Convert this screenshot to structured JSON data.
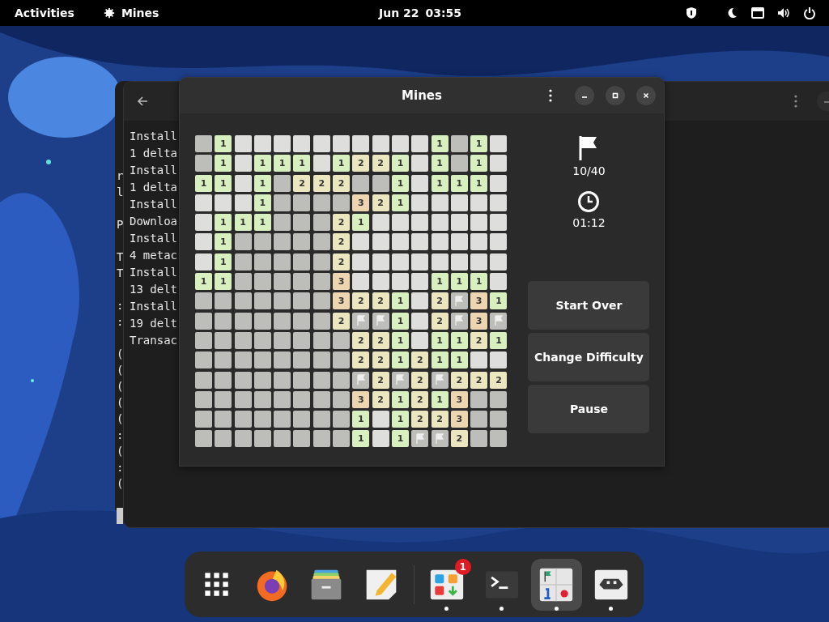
{
  "top_bar": {
    "activities": "Activities",
    "app_name": "Mines",
    "date": "Jun 22",
    "time": "03:55"
  },
  "background_terminal": {
    "line_groups": [
      [
        "r",
        "l"
      ],
      [
        "P"
      ],
      [
        "T",
        "T"
      ],
      [
        ":",
        ":"
      ],
      [
        "(",
        "(",
        "(",
        "(",
        "(",
        ":",
        "(",
        ":",
        "("
      ]
    ]
  },
  "terminal": {
    "lines": [
      "Install",
      "1 delta",
      "Install",
      "1 delta",
      "Install",
      "Downloa",
      "Install",
      "4 metac",
      "Install",
      "13 delt",
      "Install",
      "19 delt",
      "Transac"
    ]
  },
  "mines_window": {
    "title": "Mines",
    "field": {
      "rows": [
        [
          {
            "kind": "hidden"
          },
          {
            "kind": "number",
            "text": "1"
          },
          {
            "kind": "open"
          },
          {
            "kind": "open"
          },
          {
            "kind": "open"
          },
          {
            "kind": "open"
          },
          {
            "kind": "open"
          },
          {
            "kind": "open"
          },
          {
            "kind": "open"
          },
          {
            "kind": "open"
          },
          {
            "kind": "open"
          },
          {
            "kind": "open"
          },
          {
            "kind": "number",
            "text": "1"
          },
          {
            "kind": "hidden"
          },
          {
            "kind": "number",
            "text": "1"
          },
          {
            "kind": "open"
          }
        ],
        [
          {
            "kind": "hidden"
          },
          {
            "kind": "number",
            "text": "1"
          },
          {
            "kind": "open"
          },
          {
            "kind": "number",
            "text": "1"
          },
          {
            "kind": "number",
            "text": "1"
          },
          {
            "kind": "number",
            "text": "1"
          },
          {
            "kind": "open"
          },
          {
            "kind": "number",
            "text": "1"
          },
          {
            "kind": "number",
            "text": "2"
          },
          {
            "kind": "number",
            "text": "2"
          },
          {
            "kind": "number",
            "text": "1"
          },
          {
            "kind": "open"
          },
          {
            "kind": "number",
            "text": "1"
          },
          {
            "kind": "hidden"
          },
          {
            "kind": "number",
            "text": "1"
          },
          {
            "kind": "open"
          }
        ],
        [
          {
            "kind": "number",
            "text": "1"
          },
          {
            "kind": "number",
            "text": "1"
          },
          {
            "kind": "open"
          },
          {
            "kind": "number",
            "text": "1"
          },
          {
            "kind": "hidden"
          },
          {
            "kind": "number",
            "text": "2"
          },
          {
            "kind": "number",
            "text": "2"
          },
          {
            "kind": "number",
            "text": "2"
          },
          {
            "kind": "hidden"
          },
          {
            "kind": "hidden"
          },
          {
            "kind": "number",
            "text": "1"
          },
          {
            "kind": "open"
          },
          {
            "kind": "number",
            "text": "1"
          },
          {
            "kind": "number",
            "text": "1"
          },
          {
            "kind": "number",
            "text": "1"
          },
          {
            "kind": "open"
          }
        ],
        [
          {
            "kind": "open"
          },
          {
            "kind": "open"
          },
          {
            "kind": "open"
          },
          {
            "kind": "number",
            "text": "1"
          },
          {
            "kind": "hidden"
          },
          {
            "kind": "hidden"
          },
          {
            "kind": "hidden"
          },
          {
            "kind": "hidden"
          },
          {
            "kind": "number",
            "text": "3"
          },
          {
            "kind": "number",
            "text": "2"
          },
          {
            "kind": "number",
            "text": "1"
          },
          {
            "kind": "open"
          },
          {
            "kind": "open"
          },
          {
            "kind": "open"
          },
          {
            "kind": "open"
          },
          {
            "kind": "open"
          }
        ],
        [
          {
            "kind": "open"
          },
          {
            "kind": "number",
            "text": "1"
          },
          {
            "kind": "number",
            "text": "1"
          },
          {
            "kind": "number",
            "text": "1"
          },
          {
            "kind": "hidden"
          },
          {
            "kind": "hidden"
          },
          {
            "kind": "hidden"
          },
          {
            "kind": "number",
            "text": "2"
          },
          {
            "kind": "number",
            "text": "1"
          },
          {
            "kind": "open"
          },
          {
            "kind": "open"
          },
          {
            "kind": "open"
          },
          {
            "kind": "open"
          },
          {
            "kind": "open"
          },
          {
            "kind": "open"
          },
          {
            "kind": "open"
          }
        ],
        [
          {
            "kind": "open"
          },
          {
            "kind": "number",
            "text": "1"
          },
          {
            "kind": "hidden"
          },
          {
            "kind": "hidden"
          },
          {
            "kind": "hidden"
          },
          {
            "kind": "hidden"
          },
          {
            "kind": "hidden"
          },
          {
            "kind": "number",
            "text": "2"
          },
          {
            "kind": "open"
          },
          {
            "kind": "open"
          },
          {
            "kind": "open"
          },
          {
            "kind": "open"
          },
          {
            "kind": "open"
          },
          {
            "kind": "open"
          },
          {
            "kind": "open"
          },
          {
            "kind": "open"
          }
        ],
        [
          {
            "kind": "open"
          },
          {
            "kind": "number",
            "text": "1"
          },
          {
            "kind": "hidden"
          },
          {
            "kind": "hidden"
          },
          {
            "kind": "hidden"
          },
          {
            "kind": "hidden"
          },
          {
            "kind": "hidden"
          },
          {
            "kind": "number",
            "text": "2"
          },
          {
            "kind": "open"
          },
          {
            "kind": "open"
          },
          {
            "kind": "open"
          },
          {
            "kind": "open"
          },
          {
            "kind": "open"
          },
          {
            "kind": "open"
          },
          {
            "kind": "open"
          },
          {
            "kind": "open"
          }
        ],
        [
          {
            "kind": "number",
            "text": "1"
          },
          {
            "kind": "number",
            "text": "1"
          },
          {
            "kind": "hidden"
          },
          {
            "kind": "hidden"
          },
          {
            "kind": "hidden"
          },
          {
            "kind": "hidden"
          },
          {
            "kind": "hidden"
          },
          {
            "kind": "number",
            "text": "3"
          },
          {
            "kind": "open"
          },
          {
            "kind": "open"
          },
          {
            "kind": "open"
          },
          {
            "kind": "open"
          },
          {
            "kind": "number",
            "text": "1"
          },
          {
            "kind": "number",
            "text": "1"
          },
          {
            "kind": "number",
            "text": "1"
          },
          {
            "kind": "open"
          }
        ],
        [
          {
            "kind": "hidden"
          },
          {
            "kind": "hidden"
          },
          {
            "kind": "hidden"
          },
          {
            "kind": "hidden"
          },
          {
            "kind": "hidden"
          },
          {
            "kind": "hidden"
          },
          {
            "kind": "hidden"
          },
          {
            "kind": "number",
            "text": "3"
          },
          {
            "kind": "number",
            "text": "2"
          },
          {
            "kind": "number",
            "text": "2"
          },
          {
            "kind": "number",
            "text": "1"
          },
          {
            "kind": "open"
          },
          {
            "kind": "number",
            "text": "2"
          },
          {
            "kind": "flag"
          },
          {
            "kind": "number",
            "text": "3"
          },
          {
            "kind": "number",
            "text": "1"
          }
        ],
        [
          {
            "kind": "hidden"
          },
          {
            "kind": "hidden"
          },
          {
            "kind": "hidden"
          },
          {
            "kind": "hidden"
          },
          {
            "kind": "hidden"
          },
          {
            "kind": "hidden"
          },
          {
            "kind": "hidden"
          },
          {
            "kind": "number",
            "text": "2"
          },
          {
            "kind": "flag"
          },
          {
            "kind": "flag"
          },
          {
            "kind": "number",
            "text": "1"
          },
          {
            "kind": "open"
          },
          {
            "kind": "number",
            "text": "2"
          },
          {
            "kind": "flag"
          },
          {
            "kind": "number",
            "text": "3"
          },
          {
            "kind": "flag"
          }
        ],
        [
          {
            "kind": "hidden"
          },
          {
            "kind": "hidden"
          },
          {
            "kind": "hidden"
          },
          {
            "kind": "hidden"
          },
          {
            "kind": "hidden"
          },
          {
            "kind": "hidden"
          },
          {
            "kind": "hidden"
          },
          {
            "kind": "hidden"
          },
          {
            "kind": "number",
            "text": "2"
          },
          {
            "kind": "number",
            "text": "2"
          },
          {
            "kind": "number",
            "text": "1"
          },
          {
            "kind": "open"
          },
          {
            "kind": "number",
            "text": "1"
          },
          {
            "kind": "number",
            "text": "1"
          },
          {
            "kind": "number",
            "text": "2"
          },
          {
            "kind": "number",
            "text": "1"
          }
        ],
        [
          {
            "kind": "hidden"
          },
          {
            "kind": "hidden"
          },
          {
            "kind": "hidden"
          },
          {
            "kind": "hidden"
          },
          {
            "kind": "hidden"
          },
          {
            "kind": "hidden"
          },
          {
            "kind": "hidden"
          },
          {
            "kind": "hidden"
          },
          {
            "kind": "number",
            "text": "2"
          },
          {
            "kind": "number",
            "text": "2"
          },
          {
            "kind": "number",
            "text": "1"
          },
          {
            "kind": "number",
            "text": "2"
          },
          {
            "kind": "number",
            "text": "1"
          },
          {
            "kind": "number",
            "text": "1"
          },
          {
            "kind": "open"
          },
          {
            "kind": "open"
          }
        ],
        [
          {
            "kind": "hidden"
          },
          {
            "kind": "hidden"
          },
          {
            "kind": "hidden"
          },
          {
            "kind": "hidden"
          },
          {
            "kind": "hidden"
          },
          {
            "kind": "hidden"
          },
          {
            "kind": "hidden"
          },
          {
            "kind": "hidden"
          },
          {
            "kind": "flag"
          },
          {
            "kind": "number",
            "text": "2"
          },
          {
            "kind": "flag"
          },
          {
            "kind": "number",
            "text": "2"
          },
          {
            "kind": "flag"
          },
          {
            "kind": "number",
            "text": "2"
          },
          {
            "kind": "number",
            "text": "2"
          },
          {
            "kind": "number",
            "text": "2"
          }
        ],
        [
          {
            "kind": "hidden"
          },
          {
            "kind": "hidden"
          },
          {
            "kind": "hidden"
          },
          {
            "kind": "hidden"
          },
          {
            "kind": "hidden"
          },
          {
            "kind": "hidden"
          },
          {
            "kind": "hidden"
          },
          {
            "kind": "hidden"
          },
          {
            "kind": "number",
            "text": "3"
          },
          {
            "kind": "number",
            "text": "2"
          },
          {
            "kind": "number",
            "text": "1"
          },
          {
            "kind": "number",
            "text": "2"
          },
          {
            "kind": "number",
            "text": "1"
          },
          {
            "kind": "number",
            "text": "3"
          },
          {
            "kind": "hidden"
          },
          {
            "kind": "hidden"
          }
        ],
        [
          {
            "kind": "hidden"
          },
          {
            "kind": "hidden"
          },
          {
            "kind": "hidden"
          },
          {
            "kind": "hidden"
          },
          {
            "kind": "hidden"
          },
          {
            "kind": "hidden"
          },
          {
            "kind": "hidden"
          },
          {
            "kind": "hidden"
          },
          {
            "kind": "number",
            "text": "1"
          },
          {
            "kind": "open"
          },
          {
            "kind": "number",
            "text": "1"
          },
          {
            "kind": "number",
            "text": "2"
          },
          {
            "kind": "number",
            "text": "2"
          },
          {
            "kind": "number",
            "text": "3"
          },
          {
            "kind": "hidden"
          },
          {
            "kind": "hidden"
          }
        ],
        [
          {
            "kind": "hidden"
          },
          {
            "kind": "hidden"
          },
          {
            "kind": "hidden"
          },
          {
            "kind": "hidden"
          },
          {
            "kind": "hidden"
          },
          {
            "kind": "hidden"
          },
          {
            "kind": "hidden"
          },
          {
            "kind": "hidden"
          },
          {
            "kind": "number",
            "text": "1"
          },
          {
            "kind": "open"
          },
          {
            "kind": "number",
            "text": "1"
          },
          {
            "kind": "flag"
          },
          {
            "kind": "flag"
          },
          {
            "kind": "number",
            "text": "2"
          },
          {
            "kind": "hidden"
          },
          {
            "kind": "hidden"
          }
        ]
      ]
    },
    "flags": "10/40",
    "elapsed": "01:12",
    "buttons": [
      "Start Over",
      "Change Difficulty",
      "Pause"
    ]
  },
  "dock": {
    "items": [
      {
        "kind": "app-grid",
        "running": false,
        "selected": false
      },
      {
        "kind": "browser",
        "running": false,
        "selected": false
      },
      {
        "kind": "files",
        "running": false,
        "selected": false
      },
      {
        "kind": "editor",
        "running": false,
        "selected": false
      },
      {
        "kind": "software",
        "running": true,
        "selected": false,
        "badge": "1"
      },
      {
        "kind": "terminal",
        "running": true,
        "selected": false
      },
      {
        "kind": "mines",
        "running": true,
        "selected": true
      },
      {
        "kind": "game",
        "running": true,
        "selected": false
      }
    ]
  }
}
